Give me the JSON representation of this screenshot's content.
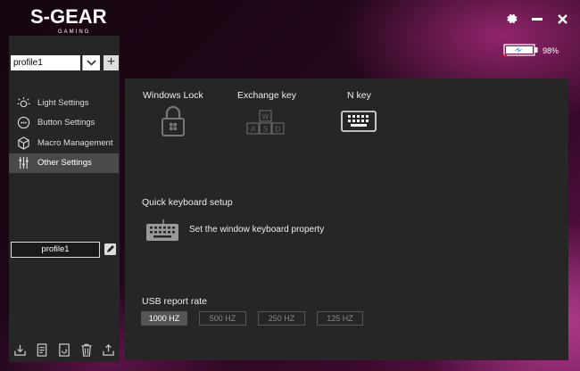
{
  "header": {
    "logo_main": "S-GEAR",
    "logo_sub": "GAMING",
    "battery_percent": "98%",
    "battery_level": 0.98,
    "icons": [
      "gear-icon",
      "minimize-icon",
      "close-icon"
    ]
  },
  "sidebar": {
    "profile_select": "profile1",
    "menu": [
      {
        "label": "Light Settings",
        "icon": "sun-icon"
      },
      {
        "label": "Button Settings",
        "icon": "button-settings-icon"
      },
      {
        "label": "Macro Management",
        "icon": "macro-cube-icon"
      },
      {
        "label": "Other Settings",
        "icon": "sliders-icon"
      }
    ],
    "active_index": 3,
    "profile_name": "profile1",
    "bottom_icons": [
      "import-icon",
      "document-icon",
      "reset-icon",
      "trash-icon",
      "export-icon"
    ]
  },
  "main": {
    "features": [
      {
        "label": "Windows Lock",
        "icon": "lock-icon"
      },
      {
        "label": "Exchange key",
        "icon": "wasd-keys-icon"
      },
      {
        "label": "N key",
        "icon": "keyboard-icon"
      }
    ],
    "keyboard_setup": {
      "title": "Quick keyboard setup",
      "text": "Set the window keyboard property",
      "icon": "keyboard-icon"
    },
    "usb": {
      "title": "USB report rate",
      "rates": [
        "1000 HZ",
        "500 HZ",
        "250 HZ",
        "125 HZ"
      ],
      "active_index": 0
    }
  },
  "colors": {
    "panel": "#262626",
    "active_item": "#4a4a4a",
    "battery_accent": "#3fa9f5"
  }
}
